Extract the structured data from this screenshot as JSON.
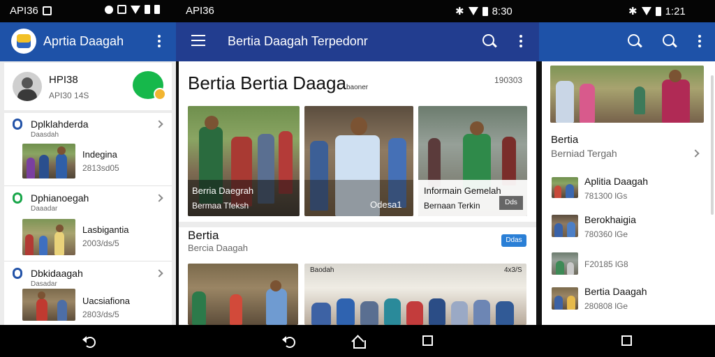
{
  "status_bar": {
    "left_label": "API36",
    "mid_label": "API36",
    "mid_time": "8:30",
    "right_time": "1:21"
  },
  "left_panel": {
    "app_title": "Aprtia Daagah",
    "profile": {
      "name": "HPI38",
      "sub": "API30 14S"
    },
    "categories": [
      {
        "title": "Dplklahderda",
        "sub": "Daasdah",
        "item_title": "Indegina",
        "item_sub": "2813sd05"
      },
      {
        "title": "Dphianoegah",
        "sub": "Daaadar",
        "item_title": "Lasbigantia",
        "item_sub": "2003/ds/5"
      },
      {
        "title": "Dbkidaagah",
        "sub": "Dasadar",
        "item_title": "Uacsiafiona",
        "item_sub": "2803/ds/5"
      }
    ]
  },
  "middle_panel": {
    "app_title": "Bertia Daagah Terpedonr",
    "headline": "Bertia Bertia Daaga",
    "headline_small": "baoner",
    "headline_meta": "190303",
    "featured": [
      {
        "title": "Berria Daegrah",
        "sub": "Bermaa Tfeksh"
      },
      {
        "title": "",
        "sub": "Odesa1"
      },
      {
        "title": "Informain Gemelah",
        "sub": "Bernaan Terkin",
        "tag": "Dds"
      }
    ],
    "section": {
      "title": "Bertia",
      "sub": "Bercia Daagah",
      "tag": "Ddas"
    },
    "grid_labels": [
      {
        "title": "Baodah",
        "meta": "4x3/S"
      }
    ]
  },
  "right_panel": {
    "category": {
      "title": "Bertia",
      "sub": "Berniad Tergah"
    },
    "items": [
      {
        "title": "Aplitia Daagah",
        "sub": "781300 lGs"
      },
      {
        "title": "Berokhaigia",
        "sub": "780360 lGe"
      },
      {
        "title": "",
        "sub": "F20185 lG8"
      },
      {
        "title": "Bertia Daagah",
        "sub": "280808 lGe"
      }
    ]
  }
}
